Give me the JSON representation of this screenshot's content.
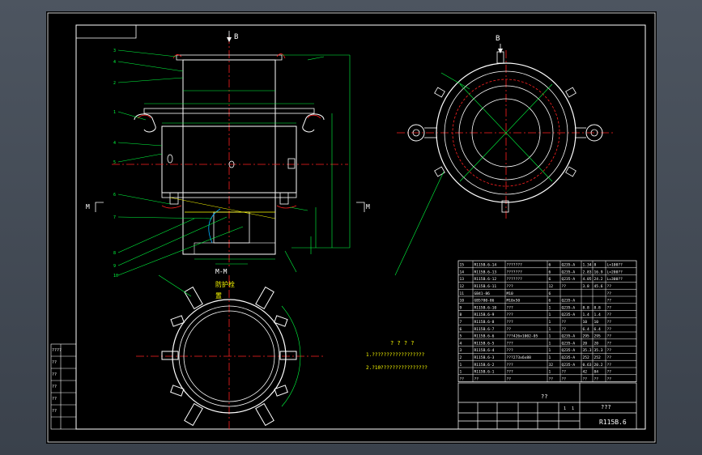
{
  "section_b_label": "B",
  "section_b_top_label": "B",
  "section_m_left": "M",
  "section_m_right": "M",
  "section_mm_label": "M-M",
  "protect_label": "防护栓",
  "protect_label2": "置",
  "tech_title": "? ? ? ?",
  "tech_note_1": "1.??????????????????",
  "tech_note_2": "2.?10????????????????",
  "part_labels_left": [
    "3",
    "4",
    "2",
    "1",
    "4",
    "5",
    "6",
    "7",
    "8",
    "9",
    "10"
  ],
  "bom_rows": [
    [
      "15",
      "R115B.6-14",
      "???????",
      "6",
      "Q235-A",
      "1.34",
      "8",
      "L=100??"
    ],
    [
      "14",
      "R115B.6-13",
      "???????",
      "6",
      "Q235-A",
      "2.83",
      "16.9",
      "L=200??"
    ],
    [
      "13",
      "R115B.6-12",
      "???????",
      "6",
      "Q235-A",
      "4.05",
      "24.2",
      "L=300??"
    ],
    [
      "12",
      "R115B.6-11",
      "???",
      "12",
      "??",
      "3.8",
      "45.6",
      "??"
    ],
    [
      "11",
      "GB41-86",
      "M10",
      "6",
      "",
      "",
      "",
      "??"
    ],
    [
      "10",
      "GB5780-86",
      "M10x50",
      "6",
      "Q235-A",
      "",
      "",
      "??"
    ],
    [
      "9",
      "R115B.6-10",
      "???",
      "1",
      "Q235-A",
      "8.8",
      "8.8",
      "??"
    ],
    [
      "8",
      "R115B.6-9",
      "???",
      "1",
      "Q235-A",
      "1.4",
      "1.4",
      "??"
    ],
    [
      "7",
      "R115B.6-8",
      "???",
      "1",
      "??",
      "10",
      "10",
      "??"
    ],
    [
      "6",
      "R115B.6-7",
      "??",
      "1",
      "??",
      "6.4",
      "6.4",
      "??"
    ],
    [
      "5",
      "R115B.6-6",
      "???426x1002-05",
      "1",
      "Q235-A",
      "295",
      "295",
      "??"
    ],
    [
      "4",
      "R115B.6-5",
      "???",
      "1",
      "Q235-A",
      "20",
      "20",
      "??"
    ],
    [
      "3",
      "R115B.6-4",
      "???",
      "1",
      "Q235-A",
      "35.3",
      "35.3",
      "??"
    ],
    [
      "2",
      "R115B.6-3",
      "???273x6x88",
      "1",
      "Q235-A",
      "252",
      "252",
      "??"
    ],
    [
      "1",
      "R115B.6-2",
      "???",
      "32",
      "Q235-A",
      "0.63",
      "20.2",
      "??"
    ],
    [
      "1",
      "R115B.6-1",
      "???",
      "1",
      "??",
      "42",
      "84",
      "??"
    ],
    [
      "??",
      "??",
      "??",
      "??",
      "??",
      "??",
      "??",
      "??"
    ]
  ],
  "title_block": {
    "name_cell": "??",
    "qty_cell": "???",
    "drawing_no": "R115B.6",
    "scale_label": "1",
    "sheet_label": "1"
  },
  "stamp_rows": [
    "????",
    "??",
    "??",
    "??",
    "??",
    "??"
  ],
  "colors": {
    "background": "#000000",
    "frame": "#ffffff",
    "centerline": "#ff2020",
    "leader": "#00ff40",
    "dimension": "#00ff40",
    "hidden": "#ffff00",
    "outline": "#ffffff",
    "window": "#4d5560"
  }
}
